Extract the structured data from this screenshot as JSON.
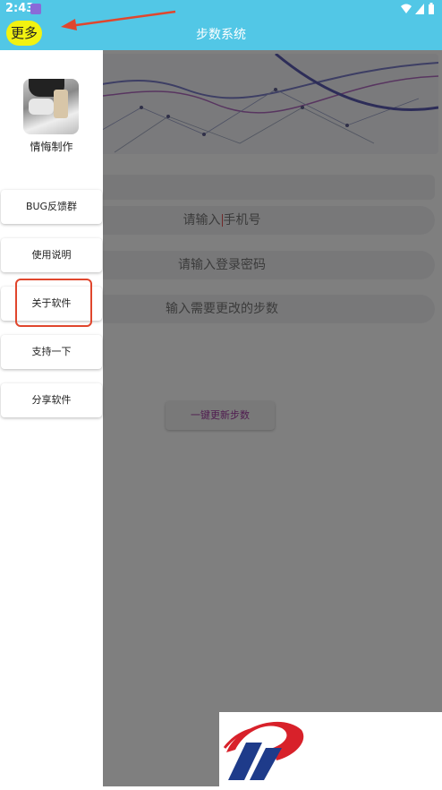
{
  "status_bar": {
    "time": "2:43"
  },
  "app_bar": {
    "more_label": "更多",
    "title": "步数系统"
  },
  "form": {
    "phone_placeholder_before": "请输入",
    "phone_placeholder_after": "手机号",
    "password_placeholder": "请输入登录密码",
    "steps_placeholder": "输入需要更改的步数",
    "update_button": "一键更新步数"
  },
  "drawer": {
    "nickname": "情悔制作",
    "menu": [
      {
        "label": "BUG反馈群"
      },
      {
        "label": "使用说明"
      },
      {
        "label": "关于软件"
      },
      {
        "label": "支持一下"
      },
      {
        "label": "分享软件"
      }
    ]
  },
  "colors": {
    "app_bar": "#52c7e6",
    "more_highlight": "#f2f211",
    "annotation_red": "#e0462d",
    "update_text": "#a03aa0",
    "logo_red": "#d8212a",
    "logo_navy": "#1e3b8a"
  }
}
